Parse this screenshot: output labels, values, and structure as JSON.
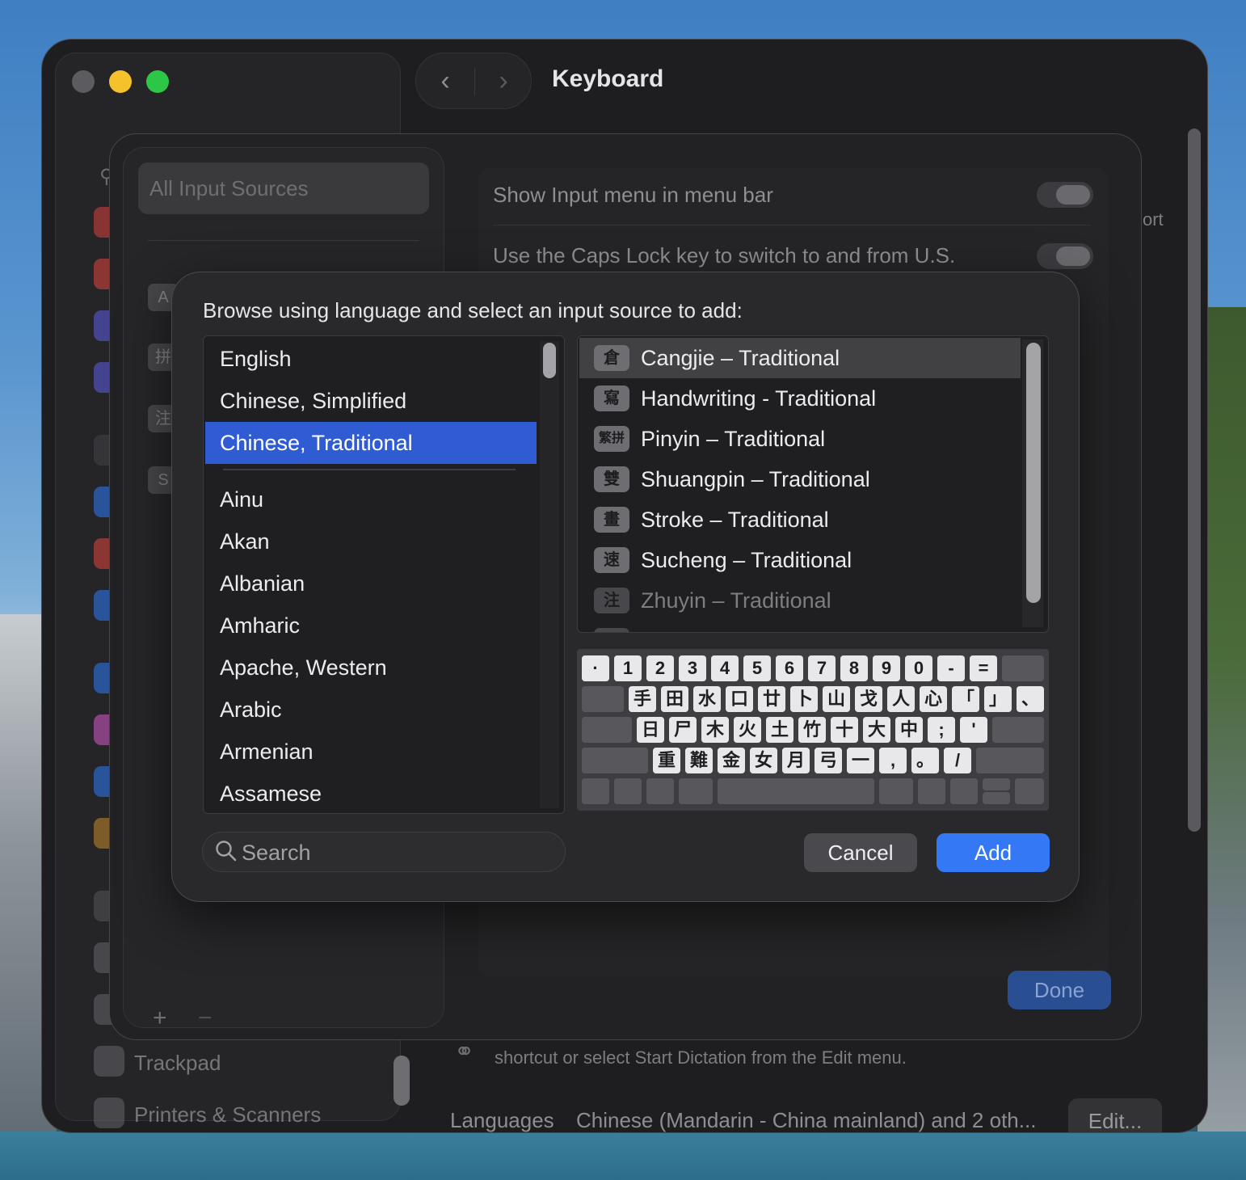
{
  "window": {
    "title": "Keyboard",
    "sidebar_items": [
      {
        "label": "Trackpad",
        "icon": "trackpad-icon"
      },
      {
        "label": "Printers & Scanners",
        "icon": "printer-icon"
      }
    ],
    "background_fragments": {
      "right_edge_text": "ort",
      "dictation_hint": "shortcut or select Start Dictation from the Edit menu.",
      "languages_label": "Languages",
      "languages_value": "Chinese (Mandarin - China mainland) and 2 oth...",
      "edit_label": "Edit..."
    }
  },
  "sheet": {
    "sidebar_selected": "All Input Sources",
    "sidebar_chips": [
      "A",
      "拼",
      "注",
      "S"
    ],
    "add_symbol": "+",
    "remove_symbol": "−",
    "rows": [
      {
        "label": "Show Input menu in menu bar",
        "on": true
      },
      {
        "label": "Use the Caps Lock key to switch to and from U.S.",
        "on": false
      }
    ],
    "done_label": "Done"
  },
  "dialog": {
    "prompt": "Browse using language and select an input source to add:",
    "languages_top": [
      "English",
      "Chinese, Simplified",
      "Chinese, Traditional"
    ],
    "languages_rest": [
      "Ainu",
      "Akan",
      "Albanian",
      "Amharic",
      "Apache, Western",
      "Arabic",
      "Armenian",
      "Assamese"
    ],
    "selected_language": "Chinese, Traditional",
    "sources": [
      {
        "glyph": "倉",
        "label": "Cangjie – Traditional",
        "selected": true,
        "dim": false
      },
      {
        "glyph": "寫",
        "label": "Handwriting - Traditional",
        "selected": false,
        "dim": false
      },
      {
        "glyph": "繁拼",
        "label": "Pinyin – Traditional",
        "selected": false,
        "dim": false
      },
      {
        "glyph": "雙",
        "label": "Shuangpin – Traditional",
        "selected": false,
        "dim": false
      },
      {
        "glyph": "畫",
        "label": "Stroke – Traditional",
        "selected": false,
        "dim": false
      },
      {
        "glyph": "速",
        "label": "Sucheng – Traditional",
        "selected": false,
        "dim": false
      },
      {
        "glyph": "注",
        "label": "Zhuyin – Traditional",
        "selected": false,
        "dim": true
      }
    ],
    "keyboard_rows": [
      [
        "·",
        "1",
        "2",
        "3",
        "4",
        "5",
        "6",
        "7",
        "8",
        "9",
        "0",
        "-",
        "="
      ],
      [
        "手",
        "田",
        "水",
        "口",
        "廿",
        "卜",
        "山",
        "戈",
        "人",
        "心",
        "「",
        "」",
        "、"
      ],
      [
        "日",
        "尸",
        "木",
        "火",
        "土",
        "竹",
        "十",
        "大",
        "中",
        ";",
        "'"
      ],
      [
        "重",
        "難",
        "金",
        "女",
        "月",
        "弓",
        "一",
        ",",
        "。",
        "/"
      ]
    ],
    "search_placeholder": "Search",
    "cancel_label": "Cancel",
    "add_label": "Add"
  },
  "colors": {
    "accent": "#3478f6",
    "selection": "#2f5cd2"
  }
}
